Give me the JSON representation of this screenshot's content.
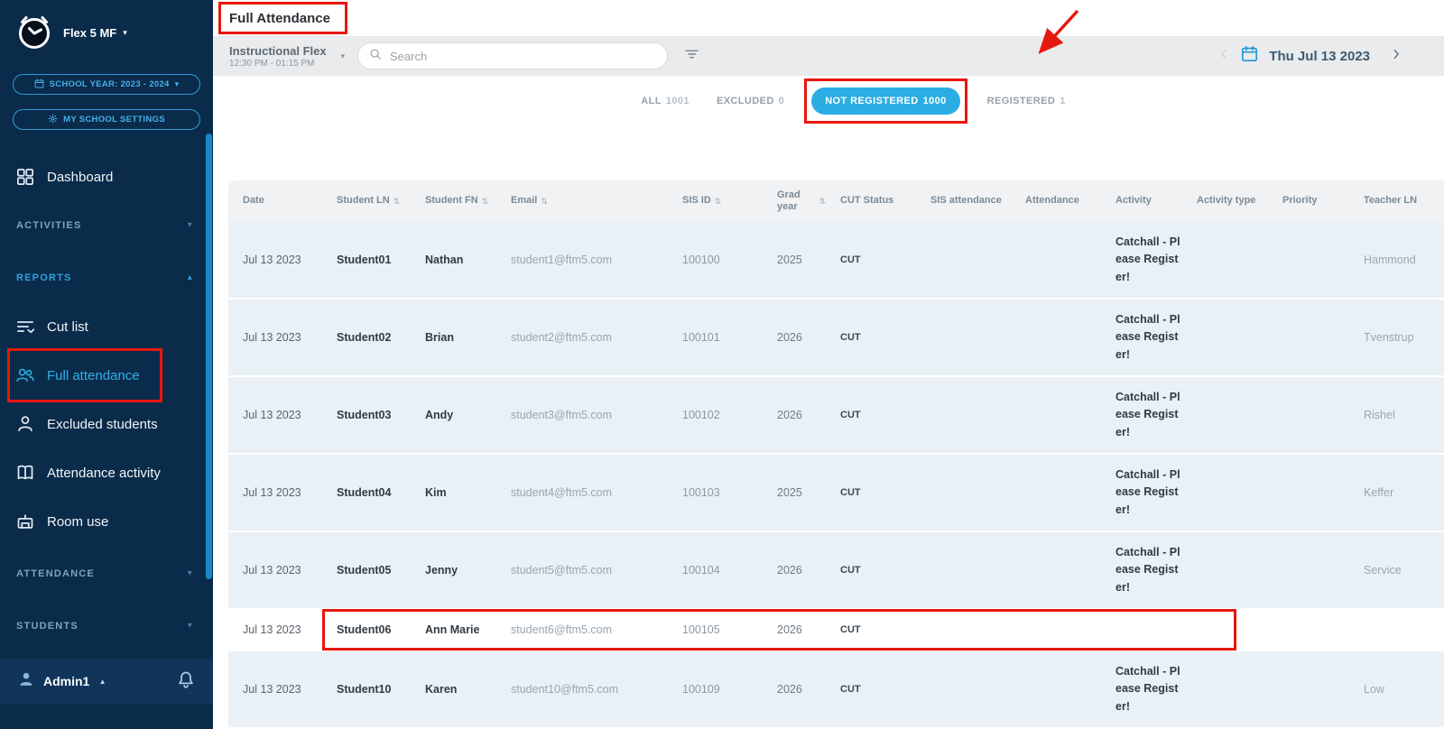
{
  "app": {
    "name": "Flex 5 MF"
  },
  "colors": {
    "accent": "#2aade3",
    "sidebar": "#0b2b4a",
    "annotation": "#e8170e"
  },
  "sidebar": {
    "school_year_button": "SCHOOL YEAR: 2023 - 2024",
    "settings_button": "MY SCHOOL SETTINGS",
    "nav": [
      {
        "type": "item",
        "label": "Dashboard",
        "icon": "dashboard",
        "active": false
      },
      {
        "type": "section",
        "label": "ACTIVITIES",
        "state": "collapsed"
      },
      {
        "type": "section",
        "label": "REPORTS",
        "state": "expanded"
      },
      {
        "type": "item",
        "label": "Cut list",
        "icon": "cut-list",
        "active": false
      },
      {
        "type": "item",
        "label": "Full attendance",
        "icon": "people",
        "active": true,
        "annotated": true
      },
      {
        "type": "item",
        "label": "Excluded students",
        "icon": "person",
        "active": false
      },
      {
        "type": "item",
        "label": "Attendance activity",
        "icon": "book",
        "active": false
      },
      {
        "type": "item",
        "label": "Room use",
        "icon": "rooms",
        "active": false
      },
      {
        "type": "section",
        "label": "ATTENDANCE",
        "state": "collapsed"
      },
      {
        "type": "section",
        "label": "STUDENTS",
        "state": "collapsed"
      }
    ],
    "user": {
      "name": "Admin1"
    }
  },
  "header": {
    "page_title": "Full Attendance",
    "activity_name": "Instructional Flex",
    "activity_time": "12:30 PM - 01:15 PM",
    "search_placeholder": "Search",
    "date_label": "Thu Jul 13 2023"
  },
  "tabs": [
    {
      "label": "ALL",
      "count": "1001",
      "active": false
    },
    {
      "label": "EXCLUDED",
      "count": "0",
      "active": false
    },
    {
      "label": "NOT REGISTERED",
      "count": "1000",
      "active": true
    },
    {
      "label": "REGISTERED",
      "count": "1",
      "active": false
    }
  ],
  "table": {
    "columns": [
      {
        "label": "Date",
        "sortable": false
      },
      {
        "label": "Student LN",
        "sortable": true
      },
      {
        "label": "Student FN",
        "sortable": true
      },
      {
        "label": "Email",
        "sortable": true
      },
      {
        "label": "SIS ID",
        "sortable": true
      },
      {
        "label": "Grad year",
        "sortable": true
      },
      {
        "label": "CUT Status",
        "sortable": false
      },
      {
        "label": "SIS attendance",
        "sortable": false
      },
      {
        "label": "Attendance",
        "sortable": false
      },
      {
        "label": "Activity",
        "sortable": false
      },
      {
        "label": "Activity type",
        "sortable": false
      },
      {
        "label": "Priority",
        "sortable": false
      },
      {
        "label": "Teacher LN",
        "sortable": false
      }
    ],
    "rows": [
      {
        "date": "Jul 13 2023",
        "student_ln": "Student01",
        "student_fn": "Nathan",
        "email": "student1@ftm5.com",
        "sis_id": "100100",
        "grad_year": "2025",
        "cut_status": "CUT",
        "sis_attendance": "",
        "attendance": "",
        "activity": "Catchall - Please Register!",
        "activity_type": "",
        "priority": "",
        "teacher_ln": "Hammond",
        "compact": false
      },
      {
        "date": "Jul 13 2023",
        "student_ln": "Student02",
        "student_fn": "Brian",
        "email": "student2@ftm5.com",
        "sis_id": "100101",
        "grad_year": "2026",
        "cut_status": "CUT",
        "sis_attendance": "",
        "attendance": "",
        "activity": "Catchall - Please Register!",
        "activity_type": "",
        "priority": "",
        "teacher_ln": "Tvenstrup",
        "compact": false
      },
      {
        "date": "Jul 13 2023",
        "student_ln": "Student03",
        "student_fn": "Andy",
        "email": "student3@ftm5.com",
        "sis_id": "100102",
        "grad_year": "2026",
        "cut_status": "CUT",
        "sis_attendance": "",
        "attendance": "",
        "activity": "Catchall - Please Register!",
        "activity_type": "",
        "priority": "",
        "teacher_ln": "Rishel",
        "compact": false
      },
      {
        "date": "Jul 13 2023",
        "student_ln": "Student04",
        "student_fn": "Kim",
        "email": "student4@ftm5.com",
        "sis_id": "100103",
        "grad_year": "2025",
        "cut_status": "CUT",
        "sis_attendance": "",
        "attendance": "",
        "activity": "Catchall - Please Register!",
        "activity_type": "",
        "priority": "",
        "teacher_ln": "Keffer",
        "compact": false
      },
      {
        "date": "Jul 13 2023",
        "student_ln": "Student05",
        "student_fn": "Jenny",
        "email": "student5@ftm5.com",
        "sis_id": "100104",
        "grad_year": "2026",
        "cut_status": "CUT",
        "sis_attendance": "",
        "attendance": "",
        "activity": "Catchall - Please Register!",
        "activity_type": "",
        "priority": "",
        "teacher_ln": "Service",
        "compact": false
      },
      {
        "date": "Jul 13 2023",
        "student_ln": "Student06",
        "student_fn": "Ann Marie",
        "email": "student6@ftm5.com",
        "sis_id": "100105",
        "grad_year": "2026",
        "cut_status": "CUT",
        "sis_attendance": "",
        "attendance": "",
        "activity": "",
        "activity_type": "",
        "priority": "",
        "teacher_ln": "",
        "compact": true
      },
      {
        "date": "Jul 13 2023",
        "student_ln": "Student10",
        "student_fn": "Karen",
        "email": "student10@ftm5.com",
        "sis_id": "100109",
        "grad_year": "2026",
        "cut_status": "CUT",
        "sis_attendance": "",
        "attendance": "",
        "activity": "Catchall - Please Register!",
        "activity_type": "",
        "priority": "",
        "teacher_ln": "Low",
        "compact": false
      }
    ]
  },
  "annotations": {
    "color": "#e8170e",
    "items": [
      "page-title-box",
      "not-registered-tab-box",
      "arrow-to-not-registered-tab",
      "sidebar-full-attendance-box",
      "student06-row-box"
    ]
  }
}
